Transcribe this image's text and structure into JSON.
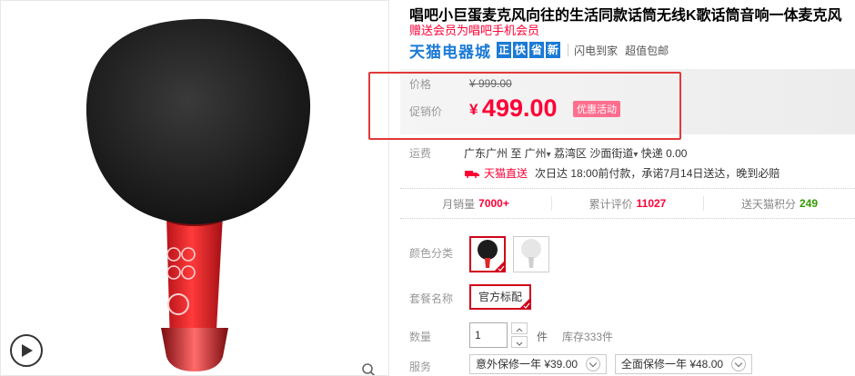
{
  "product": {
    "title": "唱吧小巨蛋麦克风向往的生活同款话筒无线K歌话筒音响一体麦克风",
    "subtitle": "赠送会员为唱吧手机会员"
  },
  "tmall": {
    "logo": "天猫电器城",
    "badges": [
      "正",
      "快",
      "省",
      "新"
    ],
    "extra": [
      "闪电到家",
      "超值包邮"
    ],
    "colors": {
      "brand_blue": "#1b7ad6"
    }
  },
  "price": {
    "price_label": "价格",
    "original": "¥ 999.00",
    "promo_label": "促销价",
    "currency": "¥",
    "promo_value": "499.00",
    "promo_tag": "优惠活动",
    "colors": {
      "price_red": "#ff0036",
      "highlight_border": "#e23838"
    }
  },
  "shipping": {
    "label": "运费",
    "from": "广东广州  至  广州",
    "district": "荔湾区 沙面街道",
    "express": "快递 0.00",
    "direct": "天猫直送",
    "eta": "次日达 18:00前付款，承诺7月14日送达，晚到必赔"
  },
  "stats": [
    {
      "label": "月销量",
      "value": "7000+",
      "color": "red"
    },
    {
      "label": "累计评价",
      "value": "11027",
      "color": "red"
    },
    {
      "label": "送天猫积分",
      "value": "249",
      "color": "green"
    }
  ],
  "options": {
    "color_label": "颜色分类",
    "package_label": "套餐名称",
    "package_value": "官方标配",
    "quantity_label": "数量",
    "quantity_value": "1",
    "quantity_unit": "件",
    "stock": "库存333件",
    "service_label": "服务",
    "services": [
      "意外保修一年 ¥39.00",
      "全面保修一年 ¥48.00"
    ]
  }
}
